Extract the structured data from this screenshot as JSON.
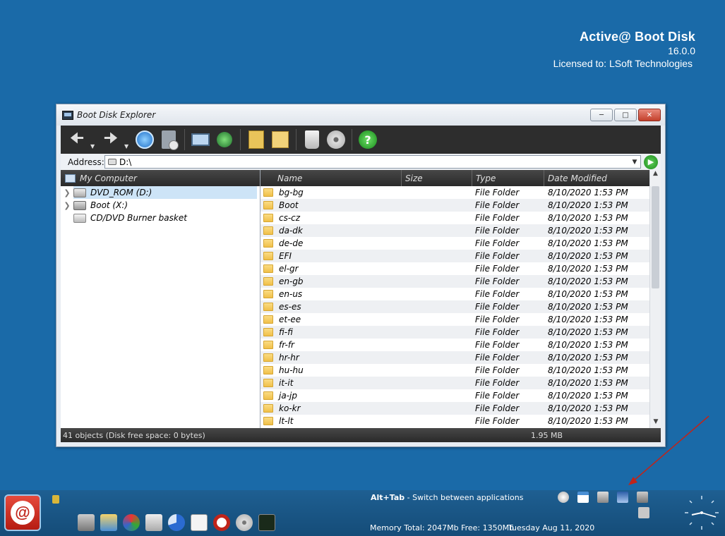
{
  "brand": {
    "title": "Active@ Boot Disk",
    "version": "16.0.0",
    "license": "Licensed to: LSoft Technologies"
  },
  "window": {
    "title": "Boot Disk Explorer",
    "address_label": "Address:",
    "address_value": "D:\\",
    "tree_header": "My Computer",
    "tree_items": [
      {
        "label": "DVD_ROM (D:)",
        "selected": true
      },
      {
        "label": "Boot (X:)",
        "selected": false
      },
      {
        "label": "CD/DVD Burner basket",
        "selected": false
      }
    ],
    "columns": {
      "name": "Name",
      "size": "Size",
      "type": "Type",
      "date": "Date Modified"
    },
    "rows": [
      {
        "name": "bg-bg",
        "type": "File Folder",
        "date": "8/10/2020 1:53 PM"
      },
      {
        "name": "Boot",
        "type": "File Folder",
        "date": "8/10/2020 1:53 PM"
      },
      {
        "name": "cs-cz",
        "type": "File Folder",
        "date": "8/10/2020 1:53 PM"
      },
      {
        "name": "da-dk",
        "type": "File Folder",
        "date": "8/10/2020 1:53 PM"
      },
      {
        "name": "de-de",
        "type": "File Folder",
        "date": "8/10/2020 1:53 PM"
      },
      {
        "name": "EFI",
        "type": "File Folder",
        "date": "8/10/2020 1:53 PM"
      },
      {
        "name": "el-gr",
        "type": "File Folder",
        "date": "8/10/2020 1:53 PM"
      },
      {
        "name": "en-gb",
        "type": "File Folder",
        "date": "8/10/2020 1:53 PM"
      },
      {
        "name": "en-us",
        "type": "File Folder",
        "date": "8/10/2020 1:53 PM"
      },
      {
        "name": "es-es",
        "type": "File Folder",
        "date": "8/10/2020 1:53 PM"
      },
      {
        "name": "et-ee",
        "type": "File Folder",
        "date": "8/10/2020 1:53 PM"
      },
      {
        "name": "fi-fi",
        "type": "File Folder",
        "date": "8/10/2020 1:53 PM"
      },
      {
        "name": "fr-fr",
        "type": "File Folder",
        "date": "8/10/2020 1:53 PM"
      },
      {
        "name": "hr-hr",
        "type": "File Folder",
        "date": "8/10/2020 1:53 PM"
      },
      {
        "name": "hu-hu",
        "type": "File Folder",
        "date": "8/10/2020 1:53 PM"
      },
      {
        "name": "it-it",
        "type": "File Folder",
        "date": "8/10/2020 1:53 PM"
      },
      {
        "name": "ja-jp",
        "type": "File Folder",
        "date": "8/10/2020 1:53 PM"
      },
      {
        "name": "ko-kr",
        "type": "File Folder",
        "date": "8/10/2020 1:53 PM"
      },
      {
        "name": "lt-lt",
        "type": "File Folder",
        "date": "8/10/2020 1:53 PM"
      }
    ],
    "status_objects": "41 objects (Disk free space: 0 bytes)",
    "status_size": "1.95 MB"
  },
  "taskbar": {
    "hint_key": "Alt+Tab",
    "hint_text": " - Switch between applications",
    "memory": "Memory Total: 2047Mb Free: 1350Mb",
    "date": "Tuesday  Aug 11, 2020"
  },
  "colors": {
    "desktop": "#1a6aa8",
    "taskbar": "#1a5a8c",
    "toolbar": "#2d2d2d",
    "folder": "#f0c04a",
    "annotation_arrow": "#c0241a"
  },
  "icons": {
    "toolbar": [
      "back-icon",
      "forward-icon",
      "refresh-icon",
      "upload-icon",
      "network-icon",
      "globe-icon",
      "calculator-icon",
      "search-folder-icon",
      "recycle-bin-icon",
      "disc-icon",
      "help-icon"
    ],
    "taskbar_apps": [
      "disk-tool-icon",
      "windows-explorer-icon",
      "partition-icon",
      "password-key-icon",
      "pie-chart-icon",
      "hex-editor-icon",
      "active-at-icon",
      "disc-burn-icon",
      "system-monitor-icon"
    ],
    "tray": [
      "clock-tray-icon",
      "window-tray-icon",
      "printer-tray-icon",
      "monitor-tray-icon",
      "network-tray-icon"
    ]
  }
}
